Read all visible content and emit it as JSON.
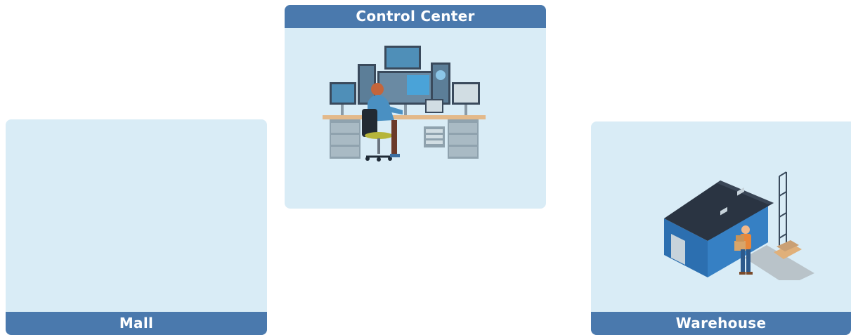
{
  "control_center": {
    "label": "Control Center",
    "illustration_icon": "operator-monitoring-station-icon"
  },
  "mall": {
    "label": "Mall"
  },
  "warehouse": {
    "label": "Warehouse",
    "illustration_icon": "warehouse-worker-icon"
  },
  "colors": {
    "panel_fill": "#d9ecf6",
    "bar_fill": "#4a79ad",
    "bar_text": "#ffffff"
  }
}
